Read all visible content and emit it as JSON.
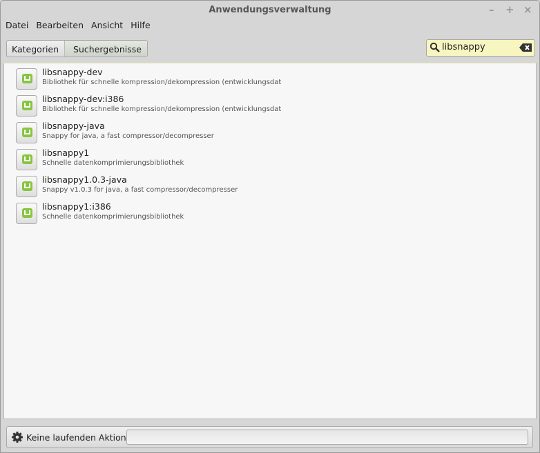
{
  "window": {
    "title": "Anwendungsverwaltung",
    "minimize": "–",
    "maximize": "+",
    "close": "×"
  },
  "menu": [
    "Datei",
    "Bearbeiten",
    "Ansicht",
    "Hilfe"
  ],
  "breadcrumb": [
    "Kategorien",
    "Suchergebnisse"
  ],
  "search": {
    "value": "libsnappy"
  },
  "packages": [
    {
      "name": "libsnappy-dev",
      "desc": "Bibliothek für schnelle kompression/dekompression (entwicklungsdateien)"
    },
    {
      "name": "libsnappy-dev:i386",
      "desc": "Bibliothek für schnelle kompression/dekompression (entwicklungsdateien)"
    },
    {
      "name": "libsnappy-java",
      "desc": "Snappy for java, a fast compressor/decompresser"
    },
    {
      "name": "libsnappy1",
      "desc": "Schnelle datenkomprimierungsbibliothek"
    },
    {
      "name": "libsnappy1.0.3-java",
      "desc": "Snappy v1.0.3 for java, a fast compressor/decompresser"
    },
    {
      "name": "libsnappy1:i386",
      "desc": "Schnelle datenkomprimierungsbibliothek"
    }
  ],
  "status": {
    "text": "Keine laufenden Aktionen",
    "progress": 0
  }
}
